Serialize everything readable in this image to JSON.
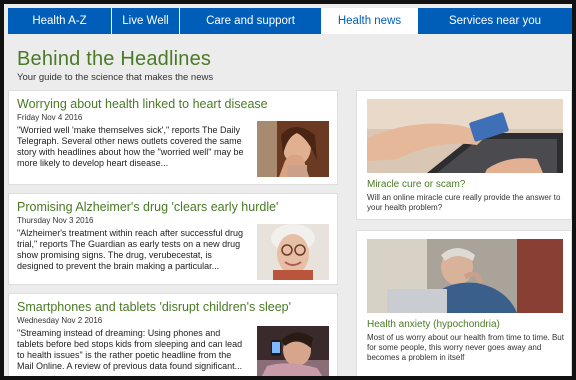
{
  "nav": {
    "tabs": [
      {
        "label": "Health A-Z"
      },
      {
        "label": "Live Well"
      },
      {
        "label": "Care and support"
      },
      {
        "label": "Health news"
      },
      {
        "label": "Services near you"
      }
    ],
    "active_tab": "Health news"
  },
  "header": {
    "title": "Behind the Headlines",
    "subtitle": "Your guide to the science that makes the news"
  },
  "articles": [
    {
      "title": "Worrying about health linked to heart disease",
      "date": "Friday Nov 4 2016",
      "summary": "\"Worried well 'make themselves sick',\" reports The Daily Telegraph. Several other news outlets covered the same story with headlines about how the \"worried well\" may be more likely to develop heart disease...",
      "thumb_icon": "worried-woman-photo"
    },
    {
      "title": "Promising Alzheimer's drug 'clears early hurdle'",
      "date": "Thursday Nov 3 2016",
      "summary": "\"Alzheimer's treatment within reach after successful drug trial,\" reports The Guardian as early tests on a new drug show promising signs. The drug, verubecestat, is designed to prevent the brain making a particular...",
      "thumb_icon": "elderly-woman-photo"
    },
    {
      "title": "Smartphones and tablets 'disrupt children's sleep'",
      "date": "Wednesday Nov 2 2016",
      "summary": "\"Streaming instead of dreaming: Using phones and tablets before bed stops kids from sleeping and can lead to health issues\" is the rather poetic headline from the Mail Online. A review of previous data found significant...",
      "thumb_icon": "child-with-phone-photo"
    }
  ],
  "sidebar": [
    {
      "title": "Miracle cure or scam?",
      "text": "Will an online miracle cure really provide the answer to your health problem?",
      "image_icon": "credit-card-laptop-photo"
    },
    {
      "title": "Health anxiety (hypochondria)",
      "text": "Most of us worry about our health from time to time. But for some people, this worry never goes away and becomes a problem in itself",
      "image_icon": "anxious-man-photo"
    }
  ],
  "colors": {
    "nav_blue": "#005eb8",
    "title_green": "#4a7a26",
    "background": "#ececec"
  }
}
